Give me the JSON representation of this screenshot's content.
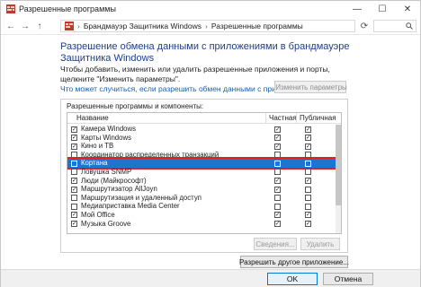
{
  "window": {
    "title": "Разрешенные программы",
    "icon": "firewall-icon",
    "controls": {
      "minimize": "—",
      "maximize": "☐",
      "close": "✕"
    }
  },
  "navbar": {
    "back": "←",
    "forward": "→",
    "up": "↑",
    "breadcrumb": [
      "Брандмауэр Защитника Windows",
      "Разрешенные программы"
    ],
    "separator": "›",
    "refresh": "⟳",
    "search_icon": "search-icon"
  },
  "main": {
    "heading": "Разрешение обмена данными с приложениями в брандмауэре Защитника Windows",
    "description": "Чтобы добавить, изменить или удалить разрешенные приложения и порты, щелкните \"Изменить параметры\".",
    "risk_link": "Что может случиться, если разрешить обмен данными с приложением?",
    "change_settings_button": "Изменить параметры",
    "group_title": "Разрешенные программы и компоненты:",
    "columns": {
      "name": "Название",
      "private": "Частная",
      "public": "Публичная"
    },
    "rows": [
      {
        "name": "Камера Windows",
        "enabled": true,
        "private": true,
        "public": true
      },
      {
        "name": "Карты Windows",
        "enabled": true,
        "private": true,
        "public": true
      },
      {
        "name": "Кино и ТВ",
        "enabled": true,
        "private": true,
        "public": true
      },
      {
        "name": "Координатор распределенных транзакций",
        "enabled": false,
        "private": false,
        "public": false
      },
      {
        "name": "Кортана",
        "enabled": false,
        "private": false,
        "public": false,
        "selected": true
      },
      {
        "name": "Ловушка SNMP",
        "enabled": false,
        "private": false,
        "public": false
      },
      {
        "name": "Люди (Майкрософт)",
        "enabled": true,
        "private": true,
        "public": true
      },
      {
        "name": "Маршрутизатор AllJoyn",
        "enabled": true,
        "private": true,
        "public": false
      },
      {
        "name": "Маршрутизация и удаленный доступ",
        "enabled": false,
        "private": false,
        "public": false
      },
      {
        "name": "Медиаприставка Media Center",
        "enabled": false,
        "private": false,
        "public": false
      },
      {
        "name": "Мой Office",
        "enabled": true,
        "private": true,
        "public": true
      },
      {
        "name": "Музыка Groove",
        "enabled": true,
        "private": true,
        "public": true
      }
    ],
    "details_button": "Сведения...",
    "delete_button": "Удалить",
    "allow_other_button": "Разрешить другое приложение..."
  },
  "footer": {
    "ok_button": "OK",
    "cancel_button": "Отмена"
  },
  "colors": {
    "accent": "#1f73d1",
    "heading": "#1e3e8a",
    "link": "#1a5fb4",
    "highlight_border": "#e02020"
  }
}
